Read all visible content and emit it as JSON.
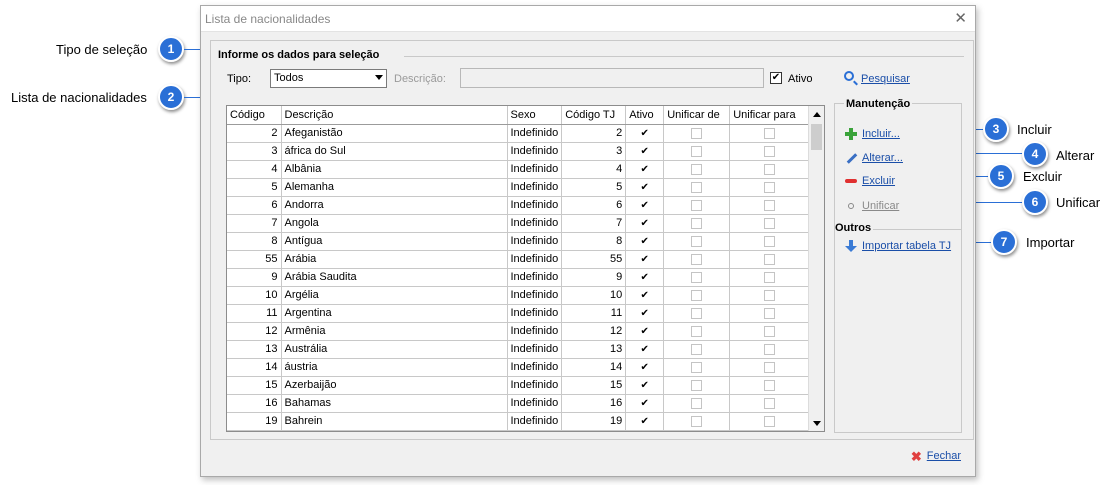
{
  "window": {
    "title": "Lista de nacionalidades",
    "close_glyph": "✕"
  },
  "selection": {
    "group_title": "Informe os dados para seleção",
    "tipo_label": "Tipo:",
    "tipo_value": "Todos",
    "descricao_label": "Descrição:",
    "descricao_value": "",
    "ativo_label": "Ativo",
    "ativo_checked": true,
    "pesquisar_label": "Pesquisar"
  },
  "grid": {
    "columns": [
      "Código",
      "Descrição",
      "Sexo",
      "Código TJ",
      "Ativo",
      "Unificar de",
      "Unificar para"
    ],
    "rows": [
      {
        "codigo": "2",
        "descricao": "Afeganistão",
        "sexo": "Indefinido",
        "codigo_tj": "2",
        "ativo": true
      },
      {
        "codigo": "3",
        "descricao": "áfrica do Sul",
        "sexo": "Indefinido",
        "codigo_tj": "3",
        "ativo": true
      },
      {
        "codigo": "4",
        "descricao": "Albânia",
        "sexo": "Indefinido",
        "codigo_tj": "4",
        "ativo": true
      },
      {
        "codigo": "5",
        "descricao": "Alemanha",
        "sexo": "Indefinido",
        "codigo_tj": "5",
        "ativo": true
      },
      {
        "codigo": "6",
        "descricao": "Andorra",
        "sexo": "Indefinido",
        "codigo_tj": "6",
        "ativo": true
      },
      {
        "codigo": "7",
        "descricao": "Angola",
        "sexo": "Indefinido",
        "codigo_tj": "7",
        "ativo": true
      },
      {
        "codigo": "8",
        "descricao": "Antígua",
        "sexo": "Indefinido",
        "codigo_tj": "8",
        "ativo": true
      },
      {
        "codigo": "55",
        "descricao": "Arábia",
        "sexo": "Indefinido",
        "codigo_tj": "55",
        "ativo": true
      },
      {
        "codigo": "9",
        "descricao": "Arábia Saudita",
        "sexo": "Indefinido",
        "codigo_tj": "9",
        "ativo": true
      },
      {
        "codigo": "10",
        "descricao": "Argélia",
        "sexo": "Indefinido",
        "codigo_tj": "10",
        "ativo": true
      },
      {
        "codigo": "11",
        "descricao": "Argentina",
        "sexo": "Indefinido",
        "codigo_tj": "11",
        "ativo": true
      },
      {
        "codigo": "12",
        "descricao": "Armênia",
        "sexo": "Indefinido",
        "codigo_tj": "12",
        "ativo": true
      },
      {
        "codigo": "13",
        "descricao": "Austrália",
        "sexo": "Indefinido",
        "codigo_tj": "13",
        "ativo": true
      },
      {
        "codigo": "14",
        "descricao": "áustria",
        "sexo": "Indefinido",
        "codigo_tj": "14",
        "ativo": true
      },
      {
        "codigo": "15",
        "descricao": "Azerbaijão",
        "sexo": "Indefinido",
        "codigo_tj": "15",
        "ativo": true
      },
      {
        "codigo": "16",
        "descricao": "Bahamas",
        "sexo": "Indefinido",
        "codigo_tj": "16",
        "ativo": true
      },
      {
        "codigo": "19",
        "descricao": "Bahrein",
        "sexo": "Indefinido",
        "codigo_tj": "19",
        "ativo": true
      }
    ]
  },
  "maintenance": {
    "group_title": "Manutenção",
    "incluir": "Incluir...",
    "alterar": "Alterar...",
    "excluir": "Excluir",
    "unificar": "Unificar"
  },
  "others": {
    "group_title": "Outros",
    "importar": "Importar tabela TJ"
  },
  "footer": {
    "fechar": "Fechar"
  },
  "callouts": [
    {
      "number": "1",
      "label": "Tipo de seleção"
    },
    {
      "number": "2",
      "label": "Lista de nacionalidades"
    },
    {
      "number": "3",
      "label": "Incluir"
    },
    {
      "number": "4",
      "label": "Alterar"
    },
    {
      "number": "5",
      "label": "Excluir"
    },
    {
      "number": "6",
      "label": "Unificar"
    },
    {
      "number": "7",
      "label": "Importar"
    }
  ],
  "colors": {
    "badge": "#2a6fd6",
    "link": "#1a4ea8"
  }
}
